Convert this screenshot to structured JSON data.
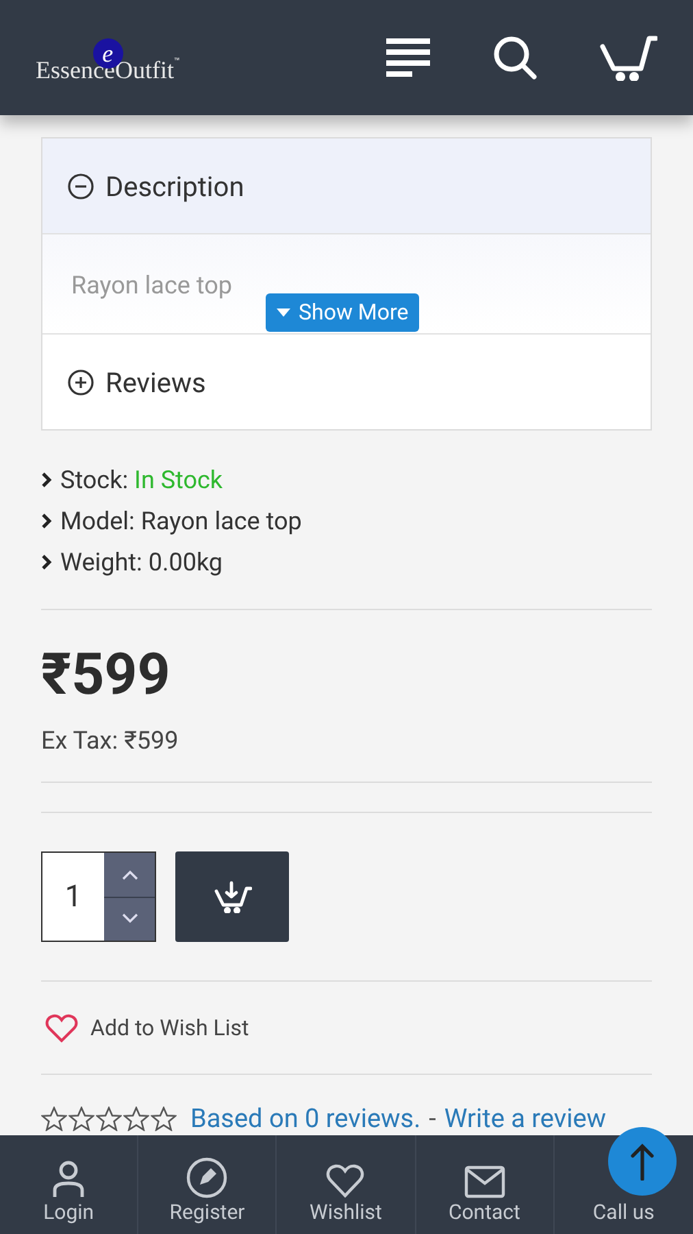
{
  "header": {
    "logo_mark": "e",
    "logo_text": "EssenceOutfit",
    "logo_trademark": "™"
  },
  "accordion": [
    {
      "title": "Description",
      "expanded": true,
      "body": "Rayon lace top",
      "more_button": "Show More"
    },
    {
      "title": "Reviews",
      "expanded": false
    }
  ],
  "details": [
    {
      "label": "Stock:",
      "value": "In Stock",
      "kind": "status"
    },
    {
      "label": "Model:",
      "value": "Rayon lace top",
      "kind": "plain"
    },
    {
      "label": "Weight:",
      "value": "0.00kg",
      "kind": "plain"
    }
  ],
  "price": "₹599",
  "ex_tax": "Ex Tax: ₹599",
  "quantity": {
    "value": "1"
  },
  "wishlist": "Add to Wish List",
  "rating": {
    "stars": 0,
    "reviews_link": "Based on 0 reviews.",
    "separator": "-",
    "write_link": "Write a review"
  },
  "bottom_nav": [
    {
      "label": "Login"
    },
    {
      "label": "Register"
    },
    {
      "label": "Wishlist"
    },
    {
      "label": "Contact"
    },
    {
      "label": "Call us"
    }
  ]
}
